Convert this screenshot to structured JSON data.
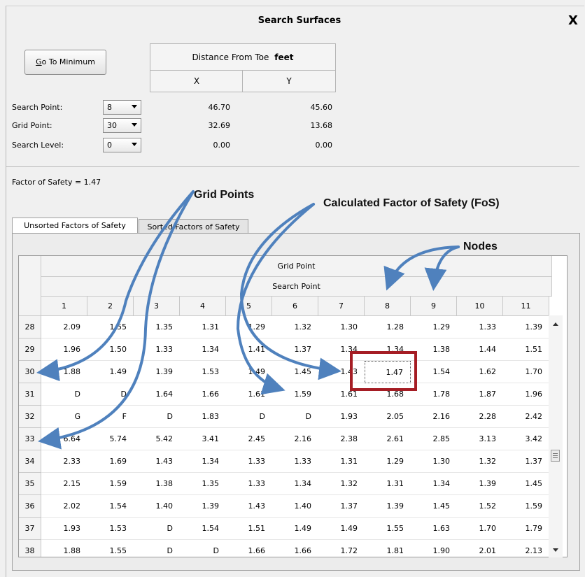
{
  "dialog": {
    "title": "Search Surfaces",
    "close_label": "X",
    "go_to_minimum_label": "Go To Minimum",
    "distance_header": "Distance From Toe",
    "distance_unit": "feet",
    "col_x": "X",
    "col_y": "Y"
  },
  "fields": [
    {
      "label": "Search Point:",
      "value": "8",
      "x": "46.70",
      "y": "45.60"
    },
    {
      "label": "Grid Point:",
      "value": "30",
      "x": "32.69",
      "y": "13.68"
    },
    {
      "label": "Search Level:",
      "value": "0",
      "x": "0.00",
      "y": "0.00"
    }
  ],
  "fos_text": "Factor of Safety = 1.47",
  "tabs": [
    "Unsorted Factors of Safety",
    "Sorted Factors of Safety"
  ],
  "table": {
    "grid_point_header": "Grid Point",
    "search_point_header": "Search Point",
    "columns": [
      "1",
      "2",
      "3",
      "4",
      "5",
      "6",
      "7",
      "8",
      "9",
      "10",
      "11"
    ],
    "rows": [
      {
        "id": "28",
        "cells": [
          "2.09",
          "1.55",
          "1.35",
          "1.31",
          "1.29",
          "1.32",
          "1.30",
          "1.28",
          "1.29",
          "1.33",
          "1.39"
        ]
      },
      {
        "id": "29",
        "cells": [
          "1.96",
          "1.50",
          "1.33",
          "1.34",
          "1.41",
          "1.37",
          "1.34",
          "1.34",
          "1.38",
          "1.44",
          "1.51"
        ]
      },
      {
        "id": "30",
        "cells": [
          "1.88",
          "1.49",
          "1.39",
          "1.53",
          "1.49",
          "1.45",
          "1.43",
          "1.47",
          "1.54",
          "1.62",
          "1.70"
        ]
      },
      {
        "id": "31",
        "cells": [
          "D",
          "D",
          "1.64",
          "1.66",
          "1.61",
          "1.59",
          "1.61",
          "1.68",
          "1.78",
          "1.87",
          "1.96"
        ]
      },
      {
        "id": "32",
        "cells": [
          "G",
          "F",
          "D",
          "1.83",
          "D",
          "D",
          "1.93",
          "2.05",
          "2.16",
          "2.28",
          "2.42"
        ]
      },
      {
        "id": "33",
        "cells": [
          "6.64",
          "5.74",
          "5.42",
          "3.41",
          "2.45",
          "2.16",
          "2.38",
          "2.61",
          "2.85",
          "3.13",
          "3.42"
        ]
      },
      {
        "id": "34",
        "cells": [
          "2.33",
          "1.69",
          "1.43",
          "1.34",
          "1.33",
          "1.33",
          "1.31",
          "1.29",
          "1.30",
          "1.32",
          "1.37"
        ]
      },
      {
        "id": "35",
        "cells": [
          "2.15",
          "1.59",
          "1.38",
          "1.35",
          "1.33",
          "1.34",
          "1.32",
          "1.31",
          "1.34",
          "1.39",
          "1.45"
        ]
      },
      {
        "id": "36",
        "cells": [
          "2.02",
          "1.54",
          "1.40",
          "1.39",
          "1.43",
          "1.40",
          "1.37",
          "1.39",
          "1.45",
          "1.52",
          "1.59"
        ]
      },
      {
        "id": "37",
        "cells": [
          "1.93",
          "1.53",
          "D",
          "1.54",
          "1.51",
          "1.49",
          "1.49",
          "1.55",
          "1.63",
          "1.70",
          "1.79"
        ]
      },
      {
        "id": "38",
        "cells": [
          "1.88",
          "1.55",
          "D",
          "D",
          "1.66",
          "1.66",
          "1.72",
          "1.81",
          "1.90",
          "2.01",
          "2.13"
        ]
      }
    ],
    "selected_row": "30",
    "selected_col": "8"
  },
  "annotations": {
    "grid_points": "Grid Points",
    "calculated_fos": "Calculated Factor of Safety (FoS)",
    "nodes": "Nodes",
    "arrow_color": "#4f81bd",
    "highlight_color": "#a51d24"
  }
}
